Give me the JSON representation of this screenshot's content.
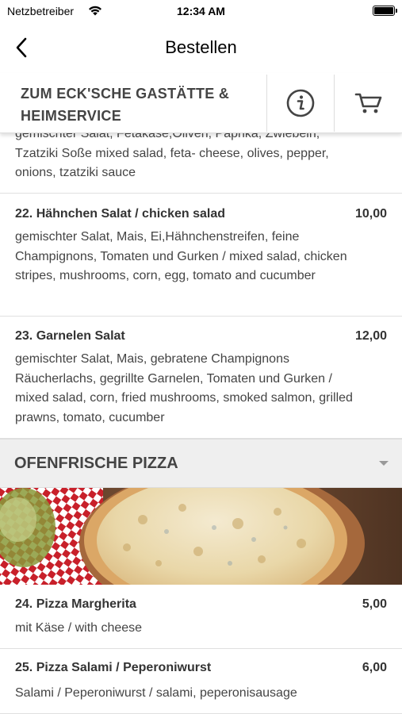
{
  "status_bar": {
    "carrier": "Netzbetreiber",
    "time": "12:34 AM"
  },
  "nav": {
    "title": "Bestellen"
  },
  "restaurant": {
    "name": "ZUM ECK'SCHE GASTÄTTE & HEIMSERVICE"
  },
  "menu": {
    "partial_item": {
      "desc_line1": "gemischter Salat, Fetakäse,Oliven, Paprika, Zwiebeln,",
      "desc_line2": "Tzatziki Soße mixed salad, feta- cheese, olives, pepper,",
      "desc_line3": "onions, tzatziki sauce"
    },
    "items": [
      {
        "title": "22. Hähnchen Salat / chicken salad",
        "price": "10,00",
        "desc": "gemischter Salat, Mais, Ei,Hähnchenstreifen, feine Champignons, Tomaten und Gurken / mixed salad, chicken stripes, mushrooms, corn, egg, tomato and cucumber"
      },
      {
        "title": "23. Garnelen Salat",
        "price": "12,00",
        "desc": "gemischter Salat, Mais, gebratene Champignons Räucherlachs, gegrillte Garnelen, Tomaten und Gurken / mixed salad, corn, fried mushrooms, smoked salmon, grilled prawns, tomato, cucumber"
      }
    ],
    "section": {
      "title": "OFENFRISCHE PIZZA"
    },
    "pizza_items": [
      {
        "title": "24. Pizza Margherita",
        "price": "5,00",
        "desc": "mit Käse / with cheese"
      },
      {
        "title": "25. Pizza Salami / Peperoniwurst",
        "price": "6,00",
        "desc": "Salami / Peperoniwurst / salami, peperonisausage"
      }
    ]
  },
  "icons": {
    "back": "chevron-left-icon",
    "info": "info-icon",
    "cart": "cart-icon",
    "wifi": "wifi-icon",
    "battery": "battery-icon",
    "section_toggle": "chevron-down-icon"
  },
  "colors": {
    "text": "#333333",
    "section_bg": "#efefef",
    "divider": "#e0e0e0"
  }
}
